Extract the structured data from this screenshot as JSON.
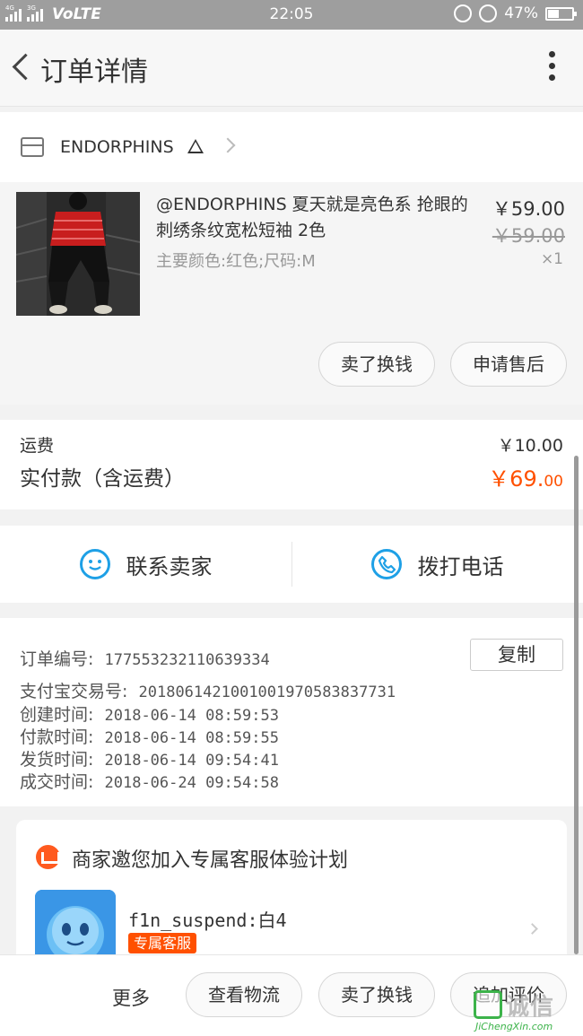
{
  "status_bar": {
    "net_top": "4G",
    "net_second": "3G",
    "volte": "VoLTE",
    "time": "22:05",
    "battery_percent": "47%",
    "battery_level": 0.47
  },
  "nav": {
    "title": "订单详情"
  },
  "shop": {
    "name": "ENDORPHINS"
  },
  "item": {
    "name": "@ENDORPHINS 夏天就是亮色系 抢眼的刺绣条纹宽松短袖 2色",
    "sku": "主要颜色:红色;尺码:M",
    "price": "￥59.00",
    "original_price": "￥59.00",
    "quantity": "×1",
    "buttons": [
      "卖了换钱",
      "申请售后"
    ]
  },
  "fee": {
    "shipping_label": "运费",
    "shipping_value": "￥10.00",
    "total_label": "实付款（含运费）",
    "total_value_main": "￥69.",
    "total_value_cents": "00"
  },
  "contact": {
    "seller_label": "联系卖家",
    "call_label": "拨打电话"
  },
  "order_info": {
    "order_no_label": "订单编号:",
    "order_no": "177553232110639334",
    "copy_label": "复制",
    "alipay_label": "支付宝交易号:",
    "alipay_no": "2018061421001001970583837731",
    "created_label": "创建时间:",
    "created": "2018-06-14 08:59:53",
    "paid_label": "付款时间:",
    "paid": "2018-06-14 08:59:55",
    "shipped_label": "发货时间:",
    "shipped": "2018-06-14 09:54:41",
    "completed_label": "成交时间:",
    "completed": "2018-06-24 09:54:58"
  },
  "service": {
    "title": "商家邀您加入专属客服体验计划",
    "agent_name": "f1n_suspend:白4",
    "badge": "专属客服"
  },
  "bottom_bar": {
    "more_label": "更多",
    "buttons": [
      "查看物流",
      "卖了换钱",
      "追加评价"
    ]
  },
  "watermark": {
    "text": "诚信",
    "url": "JiChengXin.com",
    "mark": "圖"
  },
  "colors": {
    "accent_orange": "#ff5000",
    "icon_blue": "#1ea0e6",
    "status_bar_bg": "#9e9e9e"
  }
}
